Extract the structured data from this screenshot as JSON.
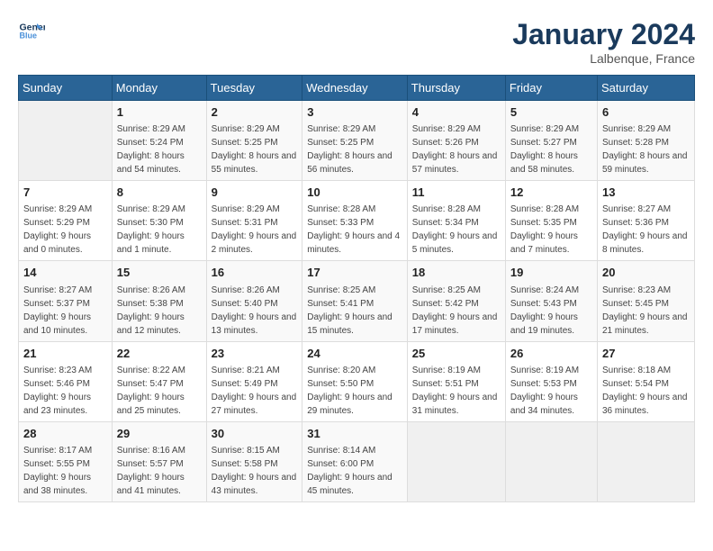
{
  "header": {
    "logo_line1": "General",
    "logo_line2": "Blue",
    "month": "January 2024",
    "location": "Lalbenque, France"
  },
  "weekdays": [
    "Sunday",
    "Monday",
    "Tuesday",
    "Wednesday",
    "Thursday",
    "Friday",
    "Saturday"
  ],
  "weeks": [
    [
      {
        "day": "",
        "sunrise": "",
        "sunset": "",
        "daylight": ""
      },
      {
        "day": "1",
        "sunrise": "Sunrise: 8:29 AM",
        "sunset": "Sunset: 5:24 PM",
        "daylight": "Daylight: 8 hours and 54 minutes."
      },
      {
        "day": "2",
        "sunrise": "Sunrise: 8:29 AM",
        "sunset": "Sunset: 5:25 PM",
        "daylight": "Daylight: 8 hours and 55 minutes."
      },
      {
        "day": "3",
        "sunrise": "Sunrise: 8:29 AM",
        "sunset": "Sunset: 5:25 PM",
        "daylight": "Daylight: 8 hours and 56 minutes."
      },
      {
        "day": "4",
        "sunrise": "Sunrise: 8:29 AM",
        "sunset": "Sunset: 5:26 PM",
        "daylight": "Daylight: 8 hours and 57 minutes."
      },
      {
        "day": "5",
        "sunrise": "Sunrise: 8:29 AM",
        "sunset": "Sunset: 5:27 PM",
        "daylight": "Daylight: 8 hours and 58 minutes."
      },
      {
        "day": "6",
        "sunrise": "Sunrise: 8:29 AM",
        "sunset": "Sunset: 5:28 PM",
        "daylight": "Daylight: 8 hours and 59 minutes."
      }
    ],
    [
      {
        "day": "7",
        "sunrise": "Sunrise: 8:29 AM",
        "sunset": "Sunset: 5:29 PM",
        "daylight": "Daylight: 9 hours and 0 minutes."
      },
      {
        "day": "8",
        "sunrise": "Sunrise: 8:29 AM",
        "sunset": "Sunset: 5:30 PM",
        "daylight": "Daylight: 9 hours and 1 minute."
      },
      {
        "day": "9",
        "sunrise": "Sunrise: 8:29 AM",
        "sunset": "Sunset: 5:31 PM",
        "daylight": "Daylight: 9 hours and 2 minutes."
      },
      {
        "day": "10",
        "sunrise": "Sunrise: 8:28 AM",
        "sunset": "Sunset: 5:33 PM",
        "daylight": "Daylight: 9 hours and 4 minutes."
      },
      {
        "day": "11",
        "sunrise": "Sunrise: 8:28 AM",
        "sunset": "Sunset: 5:34 PM",
        "daylight": "Daylight: 9 hours and 5 minutes."
      },
      {
        "day": "12",
        "sunrise": "Sunrise: 8:28 AM",
        "sunset": "Sunset: 5:35 PM",
        "daylight": "Daylight: 9 hours and 7 minutes."
      },
      {
        "day": "13",
        "sunrise": "Sunrise: 8:27 AM",
        "sunset": "Sunset: 5:36 PM",
        "daylight": "Daylight: 9 hours and 8 minutes."
      }
    ],
    [
      {
        "day": "14",
        "sunrise": "Sunrise: 8:27 AM",
        "sunset": "Sunset: 5:37 PM",
        "daylight": "Daylight: 9 hours and 10 minutes."
      },
      {
        "day": "15",
        "sunrise": "Sunrise: 8:26 AM",
        "sunset": "Sunset: 5:38 PM",
        "daylight": "Daylight: 9 hours and 12 minutes."
      },
      {
        "day": "16",
        "sunrise": "Sunrise: 8:26 AM",
        "sunset": "Sunset: 5:40 PM",
        "daylight": "Daylight: 9 hours and 13 minutes."
      },
      {
        "day": "17",
        "sunrise": "Sunrise: 8:25 AM",
        "sunset": "Sunset: 5:41 PM",
        "daylight": "Daylight: 9 hours and 15 minutes."
      },
      {
        "day": "18",
        "sunrise": "Sunrise: 8:25 AM",
        "sunset": "Sunset: 5:42 PM",
        "daylight": "Daylight: 9 hours and 17 minutes."
      },
      {
        "day": "19",
        "sunrise": "Sunrise: 8:24 AM",
        "sunset": "Sunset: 5:43 PM",
        "daylight": "Daylight: 9 hours and 19 minutes."
      },
      {
        "day": "20",
        "sunrise": "Sunrise: 8:23 AM",
        "sunset": "Sunset: 5:45 PM",
        "daylight": "Daylight: 9 hours and 21 minutes."
      }
    ],
    [
      {
        "day": "21",
        "sunrise": "Sunrise: 8:23 AM",
        "sunset": "Sunset: 5:46 PM",
        "daylight": "Daylight: 9 hours and 23 minutes."
      },
      {
        "day": "22",
        "sunrise": "Sunrise: 8:22 AM",
        "sunset": "Sunset: 5:47 PM",
        "daylight": "Daylight: 9 hours and 25 minutes."
      },
      {
        "day": "23",
        "sunrise": "Sunrise: 8:21 AM",
        "sunset": "Sunset: 5:49 PM",
        "daylight": "Daylight: 9 hours and 27 minutes."
      },
      {
        "day": "24",
        "sunrise": "Sunrise: 8:20 AM",
        "sunset": "Sunset: 5:50 PM",
        "daylight": "Daylight: 9 hours and 29 minutes."
      },
      {
        "day": "25",
        "sunrise": "Sunrise: 8:19 AM",
        "sunset": "Sunset: 5:51 PM",
        "daylight": "Daylight: 9 hours and 31 minutes."
      },
      {
        "day": "26",
        "sunrise": "Sunrise: 8:19 AM",
        "sunset": "Sunset: 5:53 PM",
        "daylight": "Daylight: 9 hours and 34 minutes."
      },
      {
        "day": "27",
        "sunrise": "Sunrise: 8:18 AM",
        "sunset": "Sunset: 5:54 PM",
        "daylight": "Daylight: 9 hours and 36 minutes."
      }
    ],
    [
      {
        "day": "28",
        "sunrise": "Sunrise: 8:17 AM",
        "sunset": "Sunset: 5:55 PM",
        "daylight": "Daylight: 9 hours and 38 minutes."
      },
      {
        "day": "29",
        "sunrise": "Sunrise: 8:16 AM",
        "sunset": "Sunset: 5:57 PM",
        "daylight": "Daylight: 9 hours and 41 minutes."
      },
      {
        "day": "30",
        "sunrise": "Sunrise: 8:15 AM",
        "sunset": "Sunset: 5:58 PM",
        "daylight": "Daylight: 9 hours and 43 minutes."
      },
      {
        "day": "31",
        "sunrise": "Sunrise: 8:14 AM",
        "sunset": "Sunset: 6:00 PM",
        "daylight": "Daylight: 9 hours and 45 minutes."
      },
      {
        "day": "",
        "sunrise": "",
        "sunset": "",
        "daylight": ""
      },
      {
        "day": "",
        "sunrise": "",
        "sunset": "",
        "daylight": ""
      },
      {
        "day": "",
        "sunrise": "",
        "sunset": "",
        "daylight": ""
      }
    ]
  ]
}
